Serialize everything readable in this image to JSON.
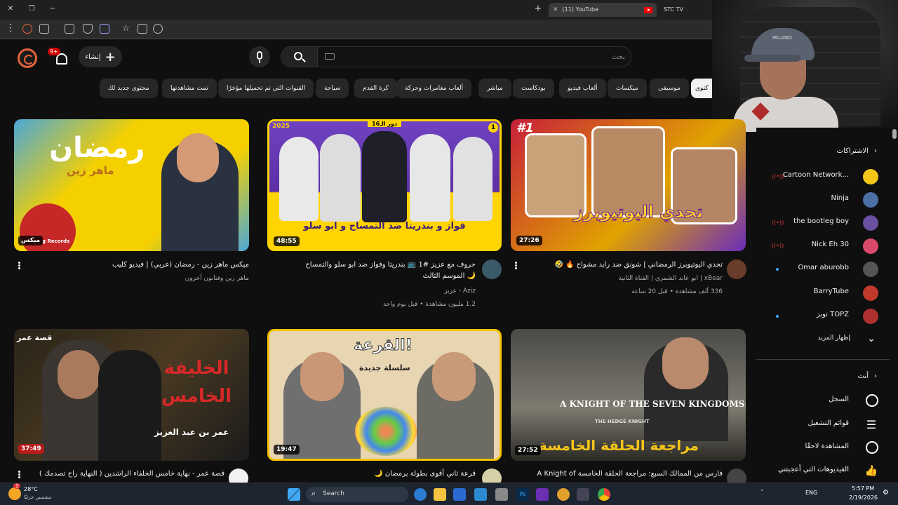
{
  "browser": {
    "tabs": [
      {
        "label": "(11) YouTube"
      },
      {
        "label": "STC TV"
      }
    ],
    "new_tab": "+"
  },
  "header": {
    "create_label": "إنشاء",
    "notif_badge": "9+",
    "search_placeholder": "بحث"
  },
  "chips": [
    "الكل",
    "موسيقى",
    "ميكسات",
    "ألعاب فيديو",
    "بودكاست",
    "مباشر",
    "ألعاب مغامرات وحركة",
    "كرة القدم",
    "سياحة",
    "القنوات التي تم تحميلها مؤخرًا",
    "تمت مشاهدتها",
    "محتوى جديد لك"
  ],
  "chips_visible_first": "كتوى",
  "videos": [
    {
      "title": "تحدي اليوتيوبرز الرمضاني | شونق ضد رايد مشواح 🔥 🤣",
      "channel": "xBear | ابو عابد الشمري | القناة الثانية",
      "meta": "336 ألف مشاهدة • قبل 20 ساعة",
      "duration": "27:26",
      "overlay": "تحدي اليوتيوبرز",
      "rank": "#1"
    },
    {
      "title": "حروف مع عزيز #1 📺 بندريتا وفواز ضد ابو سلو والتمساح",
      "title2": "🌙 الموسم الثالث",
      "channel": "Aziz - عزيز",
      "meta": "1.2 مليون مشاهدة • قبل يوم واحد",
      "duration": "48:55",
      "overlay": "فواز و بندريتا ضد التمساح و ابو سلو",
      "rank": "1",
      "badge_top": "دور الـ16",
      "badge_year": "2025"
    },
    {
      "title": "ميكس ماهر زين - رمضان (عربي) | فيديو كليب",
      "channel": "ماهر زين وفنانون آخرون",
      "duration": "ميكس",
      "overlay": "رمضان",
      "overlay2": "ماهر زين",
      "label": "g Records"
    },
    {
      "title": "فارس من الممالك السبع: مراجعة الحلقة الخامسة A Knight of",
      "duration": "27:52",
      "overlay": "مراجعة الحلقة الخامسة",
      "overlay2": "A KNIGHT OF THE SEVEN KINGDOMS:",
      "overlay3": "THE HEDGE KNIGHT"
    },
    {
      "title": "قرعة ثاني أقوى بطولة برمضان 🌙",
      "duration": "19:47",
      "overlay": "القرعة!",
      "overlay2": "سلسلة جديدة"
    },
    {
      "title": "قصة عمر - نهاية خامس الخلفاء الراشدين ( النهاية راح تصدمك )",
      "duration": "37:49",
      "overlay": "الخليفة الخامس",
      "overlay2": "عمر بن عبد العزيز",
      "overlay3": "قصة عمر"
    }
  ],
  "sidebar": {
    "subs_title": "الاشتراكات",
    "subs": [
      "Cartoon Network...",
      "Ninja",
      "the bootleg boy",
      "Nick Eh 30",
      "Omar aburobb",
      "BarryTube",
      "توبز TOPZ"
    ],
    "show_more": "إظهار المزيد",
    "you_title": "أنت",
    "you_items": [
      "السجل",
      "قوائم التشغيل",
      "المشاهدة لاحقًا",
      "الفيديوهات التي أعجبتني"
    ]
  },
  "taskbar": {
    "weather_temp": "28°C",
    "weather_desc": "مشمس جزئيًا",
    "search": "Search",
    "lang": "ENG",
    "time": "5:57 PM",
    "date": "2/19/2026",
    "notif": "2"
  },
  "webcam": {
    "cap_text": "MILANO"
  }
}
